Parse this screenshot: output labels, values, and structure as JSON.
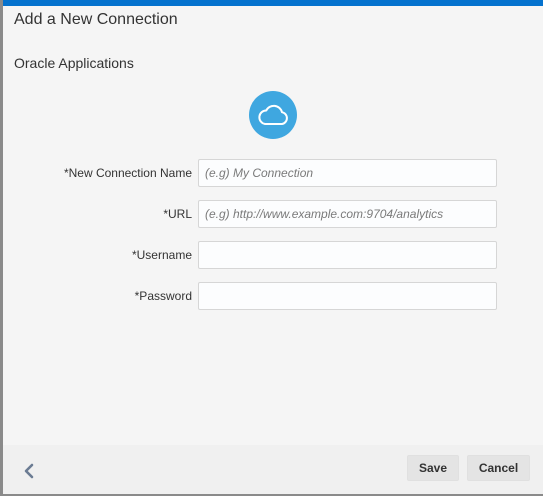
{
  "dialog": {
    "title": "Add a New Connection",
    "subtitle": "Oracle Applications",
    "icon": "cloud-icon",
    "accent_color": "#0572ce",
    "icon_color": "#3fa7e0"
  },
  "form": {
    "fields": [
      {
        "label": "*New Connection Name",
        "placeholder": "(e.g) My Connection",
        "value": ""
      },
      {
        "label": "*URL",
        "placeholder": "(e.g) http://www.example.com:9704/analytics",
        "value": ""
      },
      {
        "label": "*Username",
        "placeholder": "",
        "value": ""
      },
      {
        "label": "*Password",
        "placeholder": "",
        "value": ""
      }
    ]
  },
  "footer": {
    "back_icon": "chevron-left-icon",
    "save_label": "Save",
    "cancel_label": "Cancel"
  }
}
